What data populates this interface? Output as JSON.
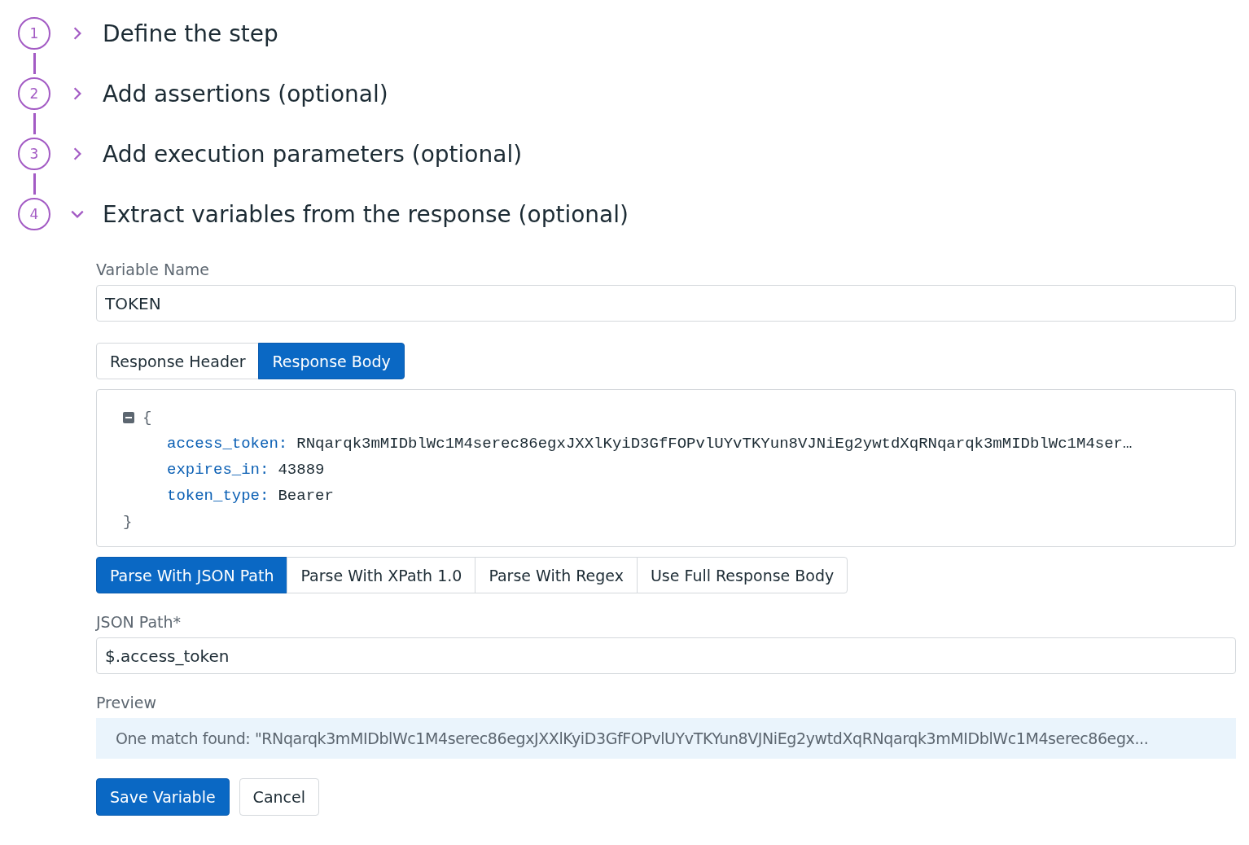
{
  "steps": [
    {
      "number": "1",
      "title": "Define the step",
      "expanded": false
    },
    {
      "number": "2",
      "title": "Add assertions (optional)",
      "expanded": false
    },
    {
      "number": "3",
      "title": "Add execution parameters (optional)",
      "expanded": false
    },
    {
      "number": "4",
      "title": "Extract variables from the response (optional)",
      "expanded": true
    }
  ],
  "variable_name": {
    "label": "Variable Name",
    "value": "TOKEN"
  },
  "source_tabs": [
    {
      "label": "Response Header",
      "selected": false
    },
    {
      "label": "Response Body",
      "selected": true
    }
  ],
  "response_body": {
    "open_brace": "{",
    "close_brace": "}",
    "collapsed": false,
    "entries": [
      {
        "key": "access_token:",
        "value": "RNqarqk3mMIDblWc1M4serec86egxJXXlKyiD3GfFOPvlUYvTKYun8VJNiEg2ywtdXqRNqarqk3mMIDblWc1M4ser…"
      },
      {
        "key": "expires_in:",
        "value": "43889"
      },
      {
        "key": "token_type:",
        "value": "Bearer"
      }
    ]
  },
  "parse_tabs": [
    {
      "label": "Parse With JSON Path",
      "selected": true
    },
    {
      "label": "Parse With XPath 1.0",
      "selected": false
    },
    {
      "label": "Parse With Regex",
      "selected": false
    },
    {
      "label": "Use Full Response Body",
      "selected": false
    }
  ],
  "json_path": {
    "label": "JSON Path*",
    "value": "$.access_token"
  },
  "preview": {
    "label": "Preview",
    "text": "One match found: \"RNqarqk3mMIDblWc1M4serec86egxJXXlKyiD3GfFOPvlUYvTKYun8VJNiEg2ywtdXqRNqarqk3mMIDblWc1M4serec86egx..."
  },
  "buttons": [
    {
      "label": "Save Variable",
      "kind": "primary"
    },
    {
      "label": "Cancel",
      "kind": "secondary"
    }
  ]
}
